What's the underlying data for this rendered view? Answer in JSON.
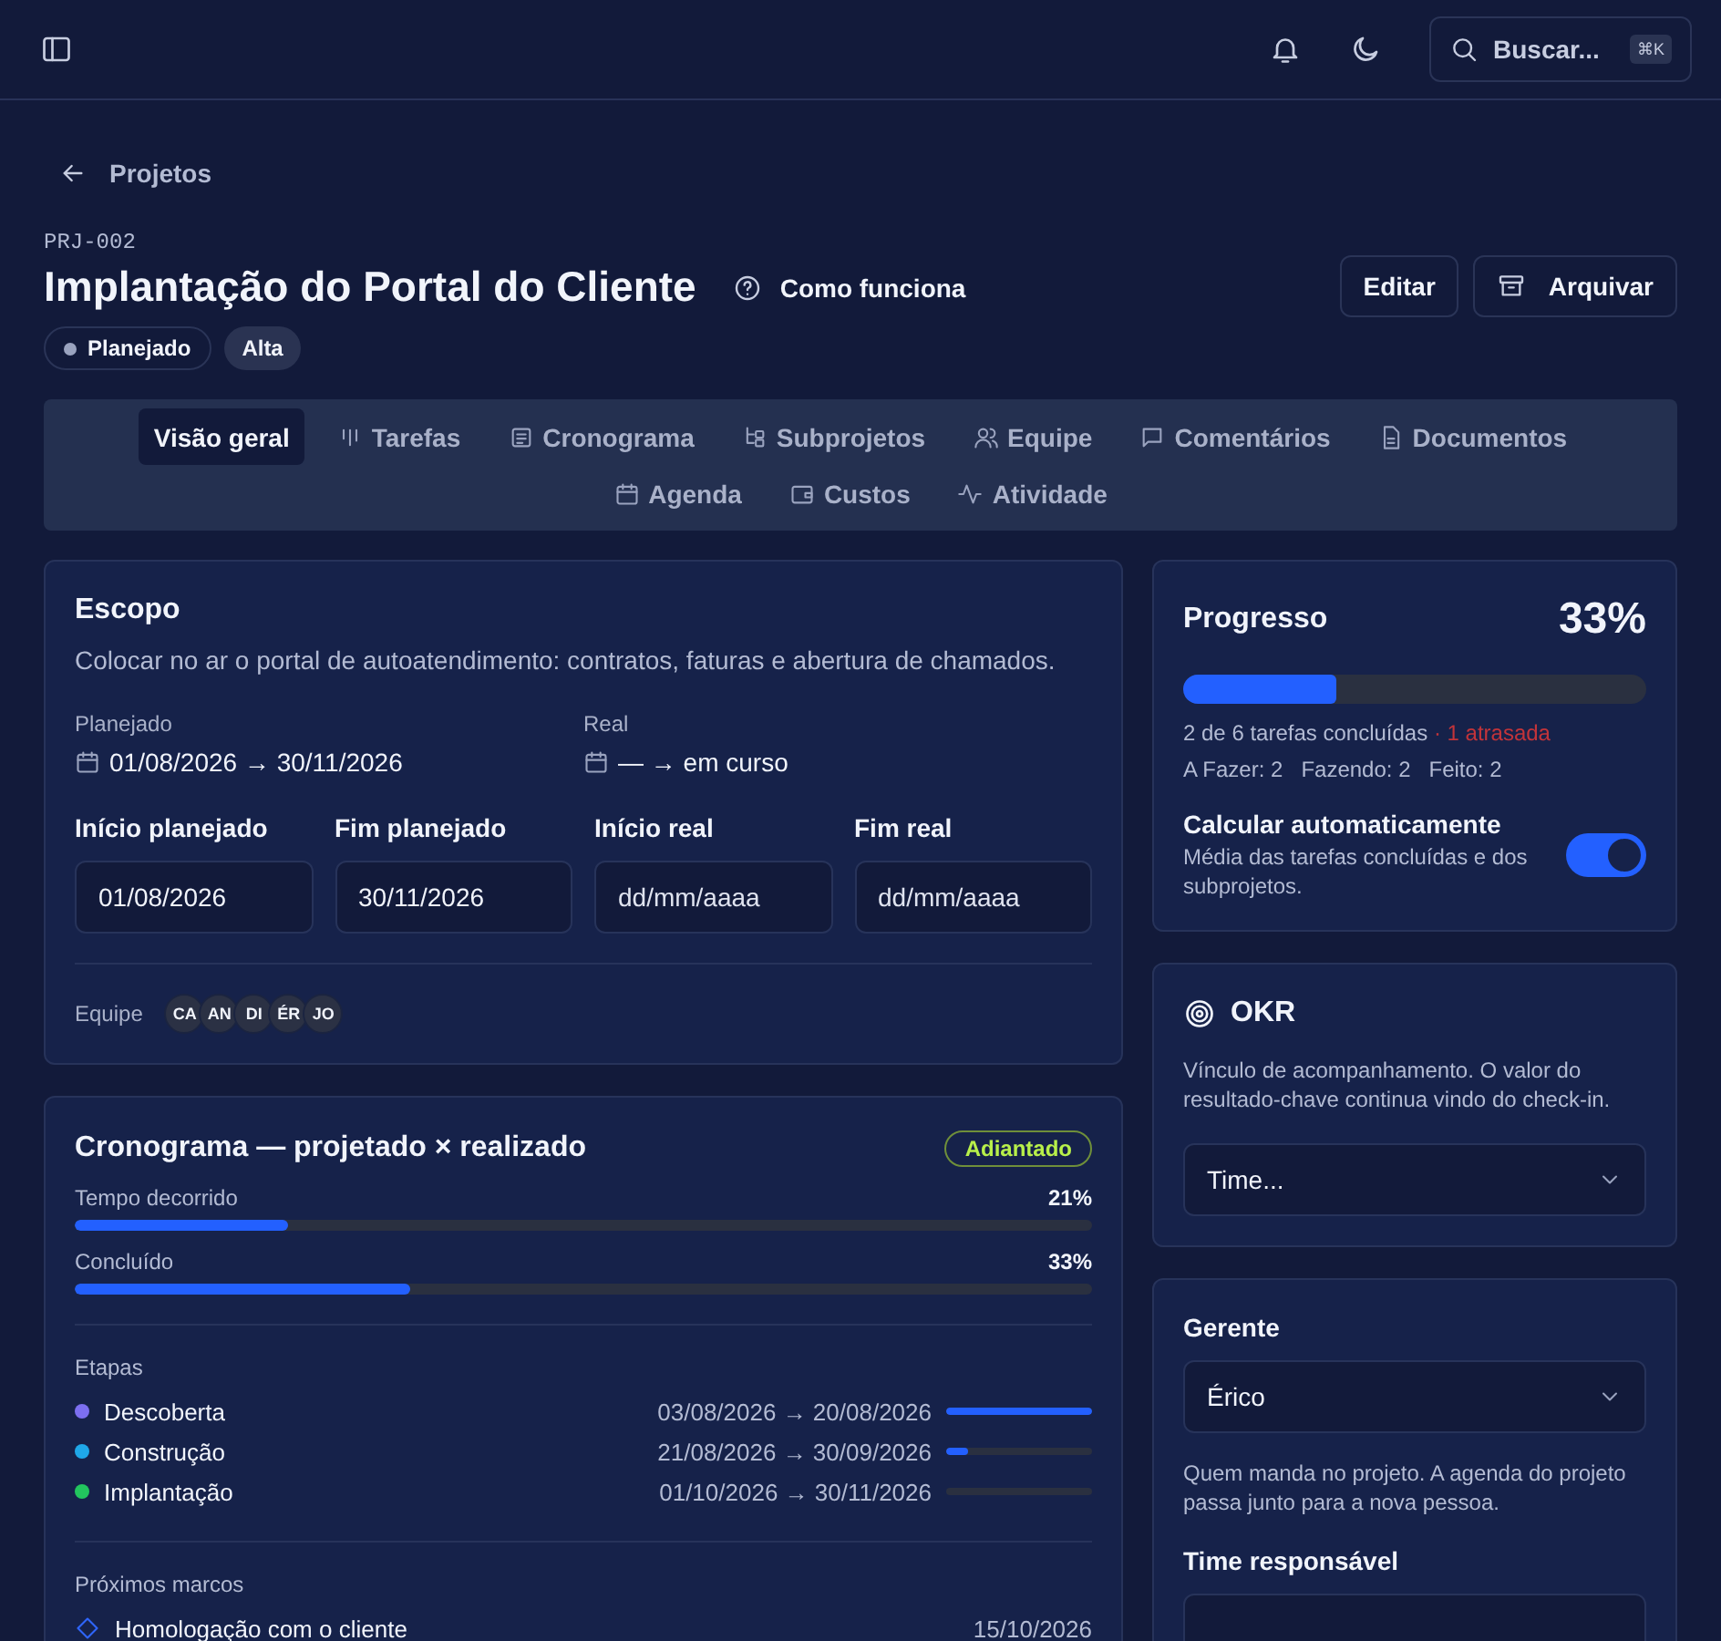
{
  "topbar": {
    "search": {
      "placeholder": "Buscar...",
      "shortcut": "⌘K"
    }
  },
  "breadcrumb": {
    "label": "Projetos"
  },
  "project": {
    "code": "PRJ-002",
    "title": "Implantação do Portal do Cliente",
    "help_link": "Como funciona",
    "badges": [
      {
        "label": "Planejado",
        "kind": "status"
      },
      {
        "label": "Alta",
        "kind": "priority"
      }
    ],
    "actions": [
      {
        "label": "Editar",
        "kind": "edit"
      },
      {
        "label": "Arquivar",
        "kind": "archive"
      }
    ]
  },
  "tabs": [
    {
      "label": "Visão geral",
      "kind": "overview",
      "selected": true
    },
    {
      "label": "Tarefas",
      "kind": "tasks",
      "selected": false
    },
    {
      "label": "Cronograma",
      "kind": "schedule",
      "selected": false
    },
    {
      "label": "Subprojetos",
      "kind": "subprojects",
      "selected": false
    },
    {
      "label": "Equipe",
      "kind": "team",
      "selected": false
    },
    {
      "label": "Comentários",
      "kind": "comments",
      "selected": false
    },
    {
      "label": "Documentos",
      "kind": "documents",
      "selected": false
    },
    {
      "label": "Agenda",
      "kind": "agenda",
      "selected": false
    },
    {
      "label": "Custos",
      "kind": "costs",
      "selected": false
    },
    {
      "label": "Atividade",
      "kind": "activity",
      "selected": false
    }
  ],
  "scope": {
    "title": "Escopo",
    "description": "Colocar no ar o portal de autoatendimento: contratos, faturas e abertura de chamados.",
    "periods": [
      {
        "label": "Planejado",
        "value": "01/08/2026 → 30/11/2026"
      },
      {
        "label": "Real",
        "value": "— → em curso"
      }
    ],
    "date_fields": [
      {
        "label": "Início planejado",
        "value": "01/08/2026"
      },
      {
        "label": "Fim planejado",
        "value": "30/11/2026"
      },
      {
        "label": "Início real",
        "placeholder": "dd/mm/aaaa"
      },
      {
        "label": "Fim real",
        "placeholder": "dd/mm/aaaa"
      }
    ],
    "team": {
      "label": "Equipe",
      "members": [
        "CA",
        "AN",
        "DI",
        "ÉR",
        "JO"
      ]
    }
  },
  "schedule": {
    "title": "Cronograma — projetado × realizado",
    "status": "Adiantado",
    "meters": [
      {
        "label": "Tempo decorrido",
        "reading": "21%",
        "level": 0.21
      },
      {
        "label": "Concluído",
        "reading": "33%",
        "level": 0.33
      }
    ],
    "stages_label": "Etapas",
    "stages": [
      {
        "name": "Descoberta",
        "color": "#7c6ff0",
        "dates": "03/08/2026 → 20/08/2026",
        "level": 1
      },
      {
        "name": "Construção",
        "color": "#1fa7e8",
        "dates": "21/08/2026 → 30/09/2026",
        "level": 0.15
      },
      {
        "name": "Implantação",
        "color": "#22c55e",
        "dates": "01/10/2026 → 30/11/2026",
        "level": 0
      }
    ],
    "milestones_label": "Próximos marcos",
    "milestones": [
      {
        "name": "Homologação com o cliente",
        "date": "15/10/2026"
      }
    ]
  },
  "progress": {
    "title": "Progresso",
    "percent": "33%",
    "level": 0.33,
    "summary": "2 de 6 tarefas concluídas",
    "overdue": "· 1 atrasada",
    "counts": [
      "A Fazer: 2",
      "Fazendo: 2",
      "Feito: 2"
    ],
    "auto": {
      "label": "Calcular automaticamente",
      "description": "Média das tarefas concluídas e dos subprojetos.",
      "on": true
    }
  },
  "okr": {
    "title": "OKR",
    "description": "Vínculo de acompanhamento. O valor do resultado-chave continua vindo do check-in.",
    "value": "Time..."
  },
  "manager": {
    "label": "Gerente",
    "value": "Érico",
    "help": "Quem manda no projeto. A agenda do projeto passa junto para a nova pessoa.",
    "team_label": "Time responsável"
  }
}
